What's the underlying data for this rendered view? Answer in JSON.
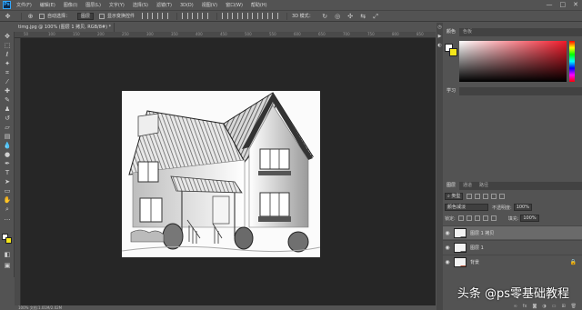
{
  "app": {
    "logo": "Ps"
  },
  "menu": [
    "文件(F)",
    "编辑(E)",
    "图像(I)",
    "图层(L)",
    "文字(Y)",
    "选择(S)",
    "滤镜(T)",
    "3D(D)",
    "视图(V)",
    "窗口(W)",
    "帮助(H)"
  ],
  "window_controls": [
    "—",
    "□",
    "✕"
  ],
  "options": {
    "auto_select": "自动选择：",
    "target": "图层",
    "transform": "显示变换控件",
    "mode_3d": "3D 模式："
  },
  "tools": [
    "move-icon",
    "marquee-icon",
    "lasso-icon",
    "magic-wand-icon",
    "crop-icon",
    "eyedropper-icon",
    "healing-icon",
    "brush-icon",
    "stamp-icon",
    "history-brush-icon",
    "eraser-icon",
    "gradient-icon",
    "blur-icon",
    "dodge-icon",
    "pen-icon",
    "type-icon",
    "path-select-icon",
    "shape-icon",
    "hand-icon",
    "zoom-icon",
    "more-icon"
  ],
  "document": {
    "tab_title": "timg.jpg @ 100% (图层 1 拷贝, RGB/8#) *",
    "close": "×",
    "status": "100%    文档:1.01M/2.02M"
  },
  "ruler_ticks": [
    "50",
    "100",
    "150",
    "200",
    "250",
    "300",
    "350",
    "400",
    "450",
    "500",
    "550",
    "600",
    "650",
    "700",
    "750",
    "800",
    "850"
  ],
  "color_panel": {
    "tabs": [
      "颜色",
      "色板"
    ],
    "fg": "#ffffff",
    "bg": "#f5e61a"
  },
  "learn_panel": {
    "tabs": [
      "学习"
    ]
  },
  "layers_panel": {
    "tabs": [
      "图层",
      "通道",
      "路径"
    ],
    "filter_kind": "类型",
    "blend_mode": "颜色减淡",
    "opacity_label": "不透明度:",
    "opacity_value": "100%",
    "lock_label": "锁定:",
    "fill_label": "填充:",
    "fill_value": "100%",
    "layers": [
      {
        "name": "图层 1 拷贝",
        "selected": true,
        "locked": false
      },
      {
        "name": "图层 1",
        "selected": false,
        "locked": false
      },
      {
        "name": "背景",
        "selected": false,
        "locked": true
      }
    ],
    "footer_icons": [
      "link-icon",
      "fx-icon",
      "mask-icon",
      "adjust-icon",
      "folder-icon",
      "new-layer-icon",
      "trash-icon"
    ]
  },
  "watermark": "头条 @ps零基础教程"
}
